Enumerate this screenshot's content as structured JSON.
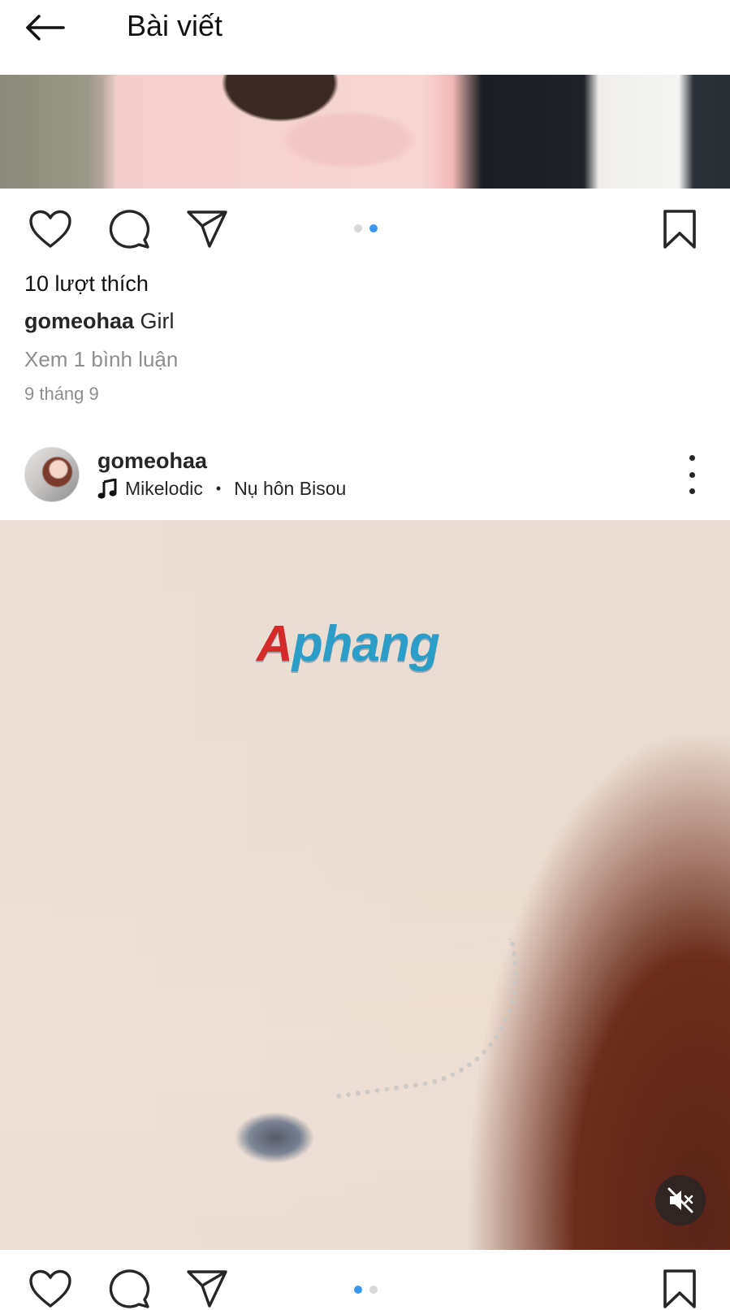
{
  "header": {
    "title": "Bài viết",
    "back_icon": "arrow-left-icon"
  },
  "post1": {
    "likes": "10 lượt thích",
    "caption_user": "gomeohaa",
    "caption_text": "Girl",
    "view_comments": "Xem 1 bình luận",
    "date": "9 tháng 9",
    "carousel": {
      "count": 2,
      "active_index": 1
    }
  },
  "post2": {
    "username": "gomeohaa",
    "music_artist": "Mikelodic",
    "music_separator": "•",
    "music_title": "Nụ hôn Bisou",
    "watermark": "Aphang",
    "carousel": {
      "count": 2,
      "active_index": 0
    }
  },
  "icons": {
    "like": "heart-icon",
    "comment": "comment-icon",
    "share": "send-icon",
    "save": "bookmark-icon",
    "mute": "speaker-muted-icon",
    "more": "more-vertical-icon",
    "music": "music-note-icon"
  },
  "colors": {
    "accent": "#3897f0",
    "text": "#262626",
    "secondary_text": "#8e8e8e"
  }
}
